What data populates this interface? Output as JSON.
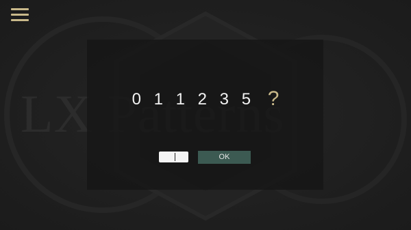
{
  "app": {
    "background_logo_text": "LX Patterns"
  },
  "menu": {
    "icon": "hamburger-menu-icon",
    "color": "#c9b98a"
  },
  "puzzle": {
    "sequence_text": "011235",
    "question_mark": "?"
  },
  "answer": {
    "value": "",
    "placeholder": ""
  },
  "buttons": {
    "ok_label": "OK"
  },
  "colors": {
    "accent": "#c9b98a",
    "ok_button": "#3c5a52",
    "dialog_bg": "#161616"
  }
}
